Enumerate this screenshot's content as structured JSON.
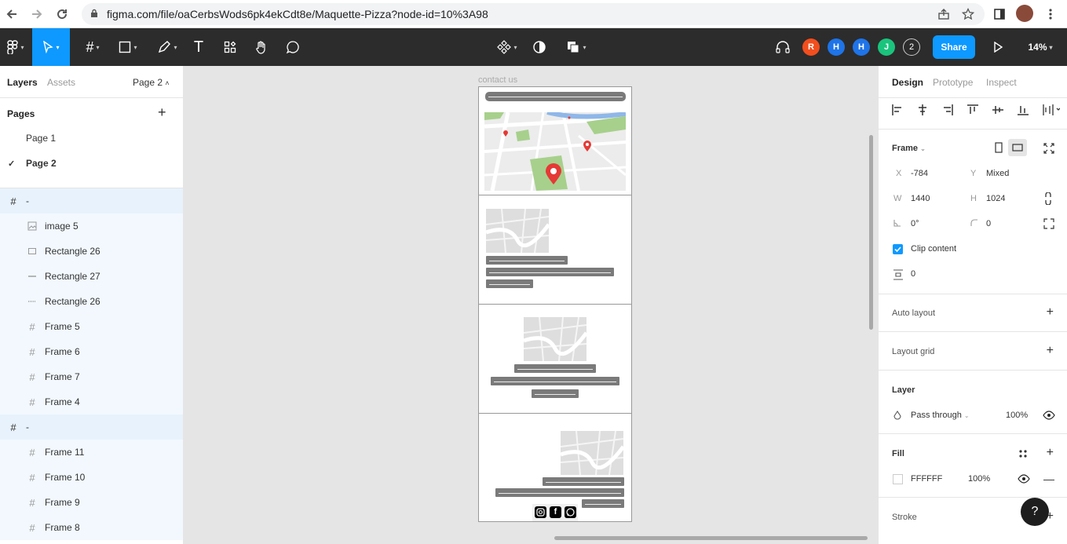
{
  "browser": {
    "url": "figma.com/file/oaCerbsWods6pk4ekCdt8e/Maquette-Pizza?node-id=10%3A98"
  },
  "toolbar": {
    "zoom": "14%",
    "share_label": "Share",
    "collaborators": [
      {
        "initial": "R",
        "color": "#f24e1e"
      },
      {
        "initial": "H",
        "color": "#1e74e8"
      },
      {
        "initial": "H",
        "color": "#1e74e8"
      },
      {
        "initial": "J",
        "color": "#1bc47d"
      }
    ],
    "extra_count": "2"
  },
  "left_panel": {
    "tabs": {
      "layers": "Layers",
      "assets": "Assets",
      "page": "Page 2"
    },
    "pages_title": "Pages",
    "pages": [
      "Page 1",
      "Page 2"
    ],
    "layers": [
      {
        "name": "-",
        "type": "frame",
        "level": 0
      },
      {
        "name": "image 5",
        "type": "image",
        "level": 1
      },
      {
        "name": "Rectangle 26",
        "type": "rect",
        "level": 1
      },
      {
        "name": "Rectangle 27",
        "type": "line",
        "level": 1
      },
      {
        "name": "Rectangle 26",
        "type": "dash",
        "level": 1
      },
      {
        "name": "Frame 5",
        "type": "frame",
        "level": 1
      },
      {
        "name": "Frame 6",
        "type": "frame",
        "level": 1
      },
      {
        "name": "Frame 7",
        "type": "frame",
        "level": 1
      },
      {
        "name": "Frame 4",
        "type": "frame",
        "level": 1
      },
      {
        "name": "-",
        "type": "frame",
        "level": 0
      },
      {
        "name": "Frame 11",
        "type": "frame",
        "level": 1
      },
      {
        "name": "Frame 10",
        "type": "frame",
        "level": 1
      },
      {
        "name": "Frame 9",
        "type": "frame",
        "level": 1
      },
      {
        "name": "Frame 8",
        "type": "frame",
        "level": 1
      }
    ]
  },
  "canvas": {
    "frame_label": "contact us"
  },
  "right_panel": {
    "tabs": {
      "design": "Design",
      "prototype": "Prototype",
      "inspect": "Inspect"
    },
    "frame_title": "Frame",
    "x_label": "X",
    "x_value": "-784",
    "y_label": "Y",
    "y_value": "Mixed",
    "w_label": "W",
    "w_value": "1440",
    "h_label": "H",
    "h_value": "1024",
    "rotation": "0°",
    "radius": "0",
    "clip_content": "Clip content",
    "spacing": "0",
    "auto_layout": "Auto layout",
    "layout_grid": "Layout grid",
    "layer_title": "Layer",
    "blend_mode": "Pass through",
    "layer_opacity": "100%",
    "fill_title": "Fill",
    "fill_hex": "FFFFFF",
    "fill_opacity": "100%",
    "stroke_title": "Stroke",
    "help": "?"
  }
}
